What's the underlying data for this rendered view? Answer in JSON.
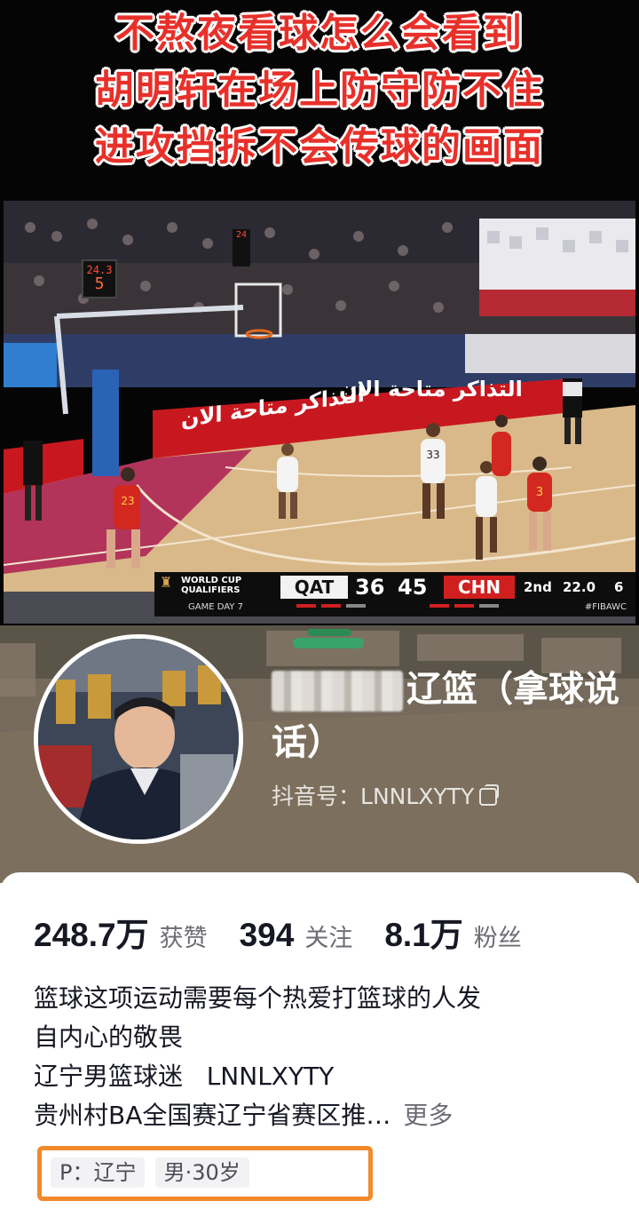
{
  "video": {
    "headline": [
      "不熬夜看球怎么会看到",
      "胡明轩在场上防守防不住",
      "进攻挡拆不会传球的画面"
    ],
    "ad_text_left": "التذاكر متاحة الان",
    "ad_text_right": "التذاكر متاحة الان",
    "shot_clock_top": "24.3",
    "shot_clock_big": "5",
    "shot_clock_2": "24",
    "jerseys": [
      "33",
      "3",
      "23"
    ],
    "scoreboard": {
      "event_line1": "WORLD CUP",
      "event_line2": "QUALIFIERS",
      "game_day": "GAME DAY 7",
      "team_home": "QAT",
      "score_home": "36",
      "score_away": "45",
      "team_away": "CHN",
      "period": "2nd",
      "clock": "22.0",
      "fouls": "6",
      "hashtag": "#FIBAWC"
    }
  },
  "profile": {
    "name_visible_part": "辽篮（拿球说话）",
    "douyin_id_label": "抖音号：",
    "douyin_id": "LNNLXYTY"
  },
  "stats": [
    {
      "value": "248.7万",
      "label": "获赞"
    },
    {
      "value": "394",
      "label": "关注"
    },
    {
      "value": "8.1万",
      "label": "粉丝"
    }
  ],
  "bio": {
    "line1": "篮球这项运动需要每个热爱打篮球的人发",
    "line2": "自内心的敬畏",
    "line3": "辽宁男篮球迷   LNNLXYTY",
    "line4": "贵州村BA全国赛辽宁省赛区推…",
    "more": "更多"
  },
  "tags": [
    "P：辽宁",
    "男·30岁"
  ],
  "colors": {
    "headline_red": "#e8302a",
    "highlight_orange": "#f08a2b",
    "chn_red": "#d01f1f"
  }
}
